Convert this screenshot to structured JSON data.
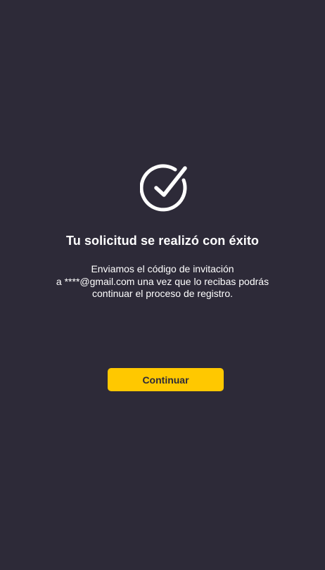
{
  "success": {
    "icon": "check-circle-icon",
    "title": "Tu solicitud se realizó con éxito",
    "message_lines": [
      "Enviamos el código de invitación",
      "a ****@gmail.com una vez que lo recibas podrás",
      "continuar el proceso de registro."
    ]
  },
  "actions": {
    "continue_label": "Continuar"
  },
  "colors": {
    "background": "#2d2a38",
    "accent": "#ffc800",
    "text": "#ffffff"
  }
}
